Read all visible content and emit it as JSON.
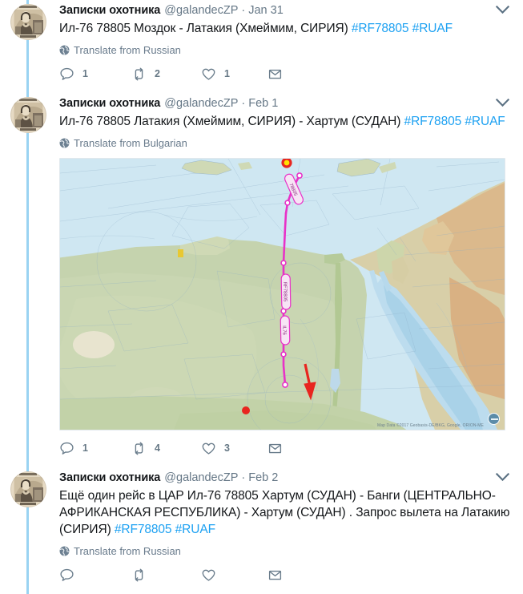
{
  "meta": {
    "accent_blue": "#1da1f2",
    "thread_line_color": "#9ad3f2",
    "muted_text": "#657786",
    "text_color": "#14171a",
    "action_color": "#667885"
  },
  "account": {
    "display_name": "Записки охотника",
    "handle": "@galandecZP",
    "avatar_name": "vintage-sepia-portrait"
  },
  "icons": {
    "caret": "chevron-down-icon",
    "globe": "globe-icon",
    "reply": "reply-icon",
    "retweet": "retweet-icon",
    "like": "heart-icon",
    "dm": "envelope-icon"
  },
  "tweets": [
    {
      "id": "tweet-jan-31",
      "display_name": "Записки охотника",
      "handle": "@galandecZP",
      "separator": "·",
      "timestamp": "Jan 31",
      "text_segments": [
        {
          "kind": "plain",
          "text": "Ил-76 78805   Моздок  -  Латакия  (Хмеймим, СИРИЯ) "
        },
        {
          "kind": "hashtag",
          "text": "#RF78805"
        },
        {
          "kind": "plain",
          "text": " "
        },
        {
          "kind": "hashtag",
          "text": "#RUAF"
        }
      ],
      "translate_label": "Translate from Russian",
      "has_media": false,
      "actions": {
        "reply_count": "1",
        "retweet_count": "2",
        "like_count": "1",
        "dm_count": ""
      }
    },
    {
      "id": "tweet-feb-1",
      "display_name": "Записки охотника",
      "handle": "@galandecZP",
      "separator": "·",
      "timestamp": "Feb 1",
      "text_segments": [
        {
          "kind": "plain",
          "text": "Ил-76 78805   Латакия  (Хмеймим, СИРИЯ)  -  Хартум  (СУДАН) "
        },
        {
          "kind": "hashtag",
          "text": "#RF78805"
        },
        {
          "kind": "plain",
          "text": " "
        },
        {
          "kind": "hashtag",
          "text": "#RUAF"
        }
      ],
      "translate_label": "Translate from Bulgarian",
      "has_media": true,
      "media": {
        "name": "flight-track-map",
        "description": "Flight tracking map showing a magenta route from the eastern Mediterranean coast south across Egypt to Sudan",
        "attribution": "Map Data ©2017 Geobasis-DE/BKG, Google, ORION-ME",
        "origin_marker": {
          "name": "origin-marker",
          "fill": "#ffe200",
          "ring": "#e8251f"
        },
        "destination_marker": {
          "name": "destination-marker",
          "fill": "#e8251f"
        },
        "arrow_marker": {
          "name": "direction-arrow",
          "color": "#e8251f"
        },
        "track_color": "#e832c8",
        "info_button": "map-info-button"
      },
      "actions": {
        "reply_count": "1",
        "retweet_count": "4",
        "like_count": "3",
        "dm_count": ""
      }
    },
    {
      "id": "tweet-feb-2",
      "display_name": "Записки охотника",
      "handle": "@galandecZP",
      "separator": "·",
      "timestamp": "Feb 2",
      "text_segments": [
        {
          "kind": "plain",
          "text": "Ещё один рейс в ЦАР Ил-76 78805   Хартум  (СУДАН)  -  Банги (ЦЕНТРАЛЬНО-АФРИКАНСКАЯ  РЕСПУБЛИКА)  -  Хартум (СУДАН) . Запрос вылета на Латакию (СИРИЯ) "
        },
        {
          "kind": "hashtag",
          "text": "#RF78805"
        },
        {
          "kind": "plain",
          "text": " "
        },
        {
          "kind": "hashtag",
          "text": "#RUAF"
        }
      ],
      "translate_label": "Translate from Russian",
      "has_media": false,
      "actions": {
        "reply_count": "",
        "retweet_count": "",
        "like_count": "",
        "dm_count": ""
      }
    }
  ]
}
